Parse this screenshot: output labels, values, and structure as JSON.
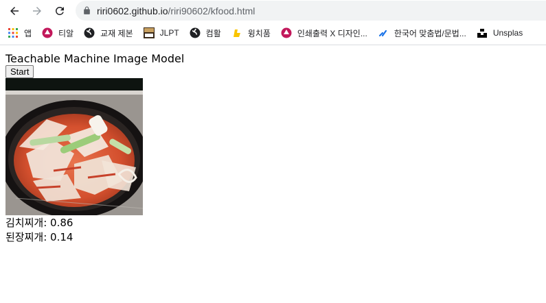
{
  "browser": {
    "url_host": "riri0602.github.io",
    "url_path": "/riri90602/kfood.html",
    "bookmarks": [
      {
        "label": "앱",
        "icon": "apps-grid-icon"
      },
      {
        "label": "티알",
        "icon": "pink-badge-icon"
      },
      {
        "label": "교재 제본",
        "icon": "globe-icon"
      },
      {
        "label": "JLPT",
        "icon": "jlpt-icon"
      },
      {
        "label": "컴활",
        "icon": "globe-icon"
      },
      {
        "label": "윙치품",
        "icon": "yellow-icon"
      },
      {
        "label": "인쇄출력 X 디자인...",
        "icon": "pink-badge-icon"
      },
      {
        "label": "한국어 맞춤법/문법...",
        "icon": "spellcheck-icon"
      },
      {
        "label": "Unsplas",
        "icon": "unsplash-icon"
      }
    ]
  },
  "page": {
    "title": "Teachable Machine Image Model",
    "start_button": "Start",
    "webcam_alt": "webcam",
    "predictions": [
      {
        "text": "김치찌개: 0.86"
      },
      {
        "text": "된장찌개: 0.14"
      }
    ]
  }
}
